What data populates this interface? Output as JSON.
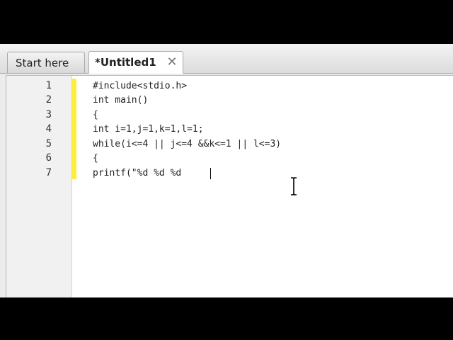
{
  "tabs": [
    {
      "label": "Start here",
      "active": false
    },
    {
      "label": "*Untitled1",
      "active": true
    }
  ],
  "editor": {
    "line_numbers": [
      "1",
      "2",
      "3",
      "4",
      "5",
      "6",
      "7"
    ],
    "lines": [
      "#include<stdio.h>",
      "int main()",
      "{",
      "int i=1,j=1,k=1,l=1;",
      "while(i<=4 || j<=4 &&k<=1 || l<=3)",
      "{",
      "printf(\"%d %d %d"
    ]
  },
  "colors": {
    "change_marker": "#ffee33",
    "editor_background": "#ffffff",
    "gutter_background": "#f1f1f1"
  }
}
